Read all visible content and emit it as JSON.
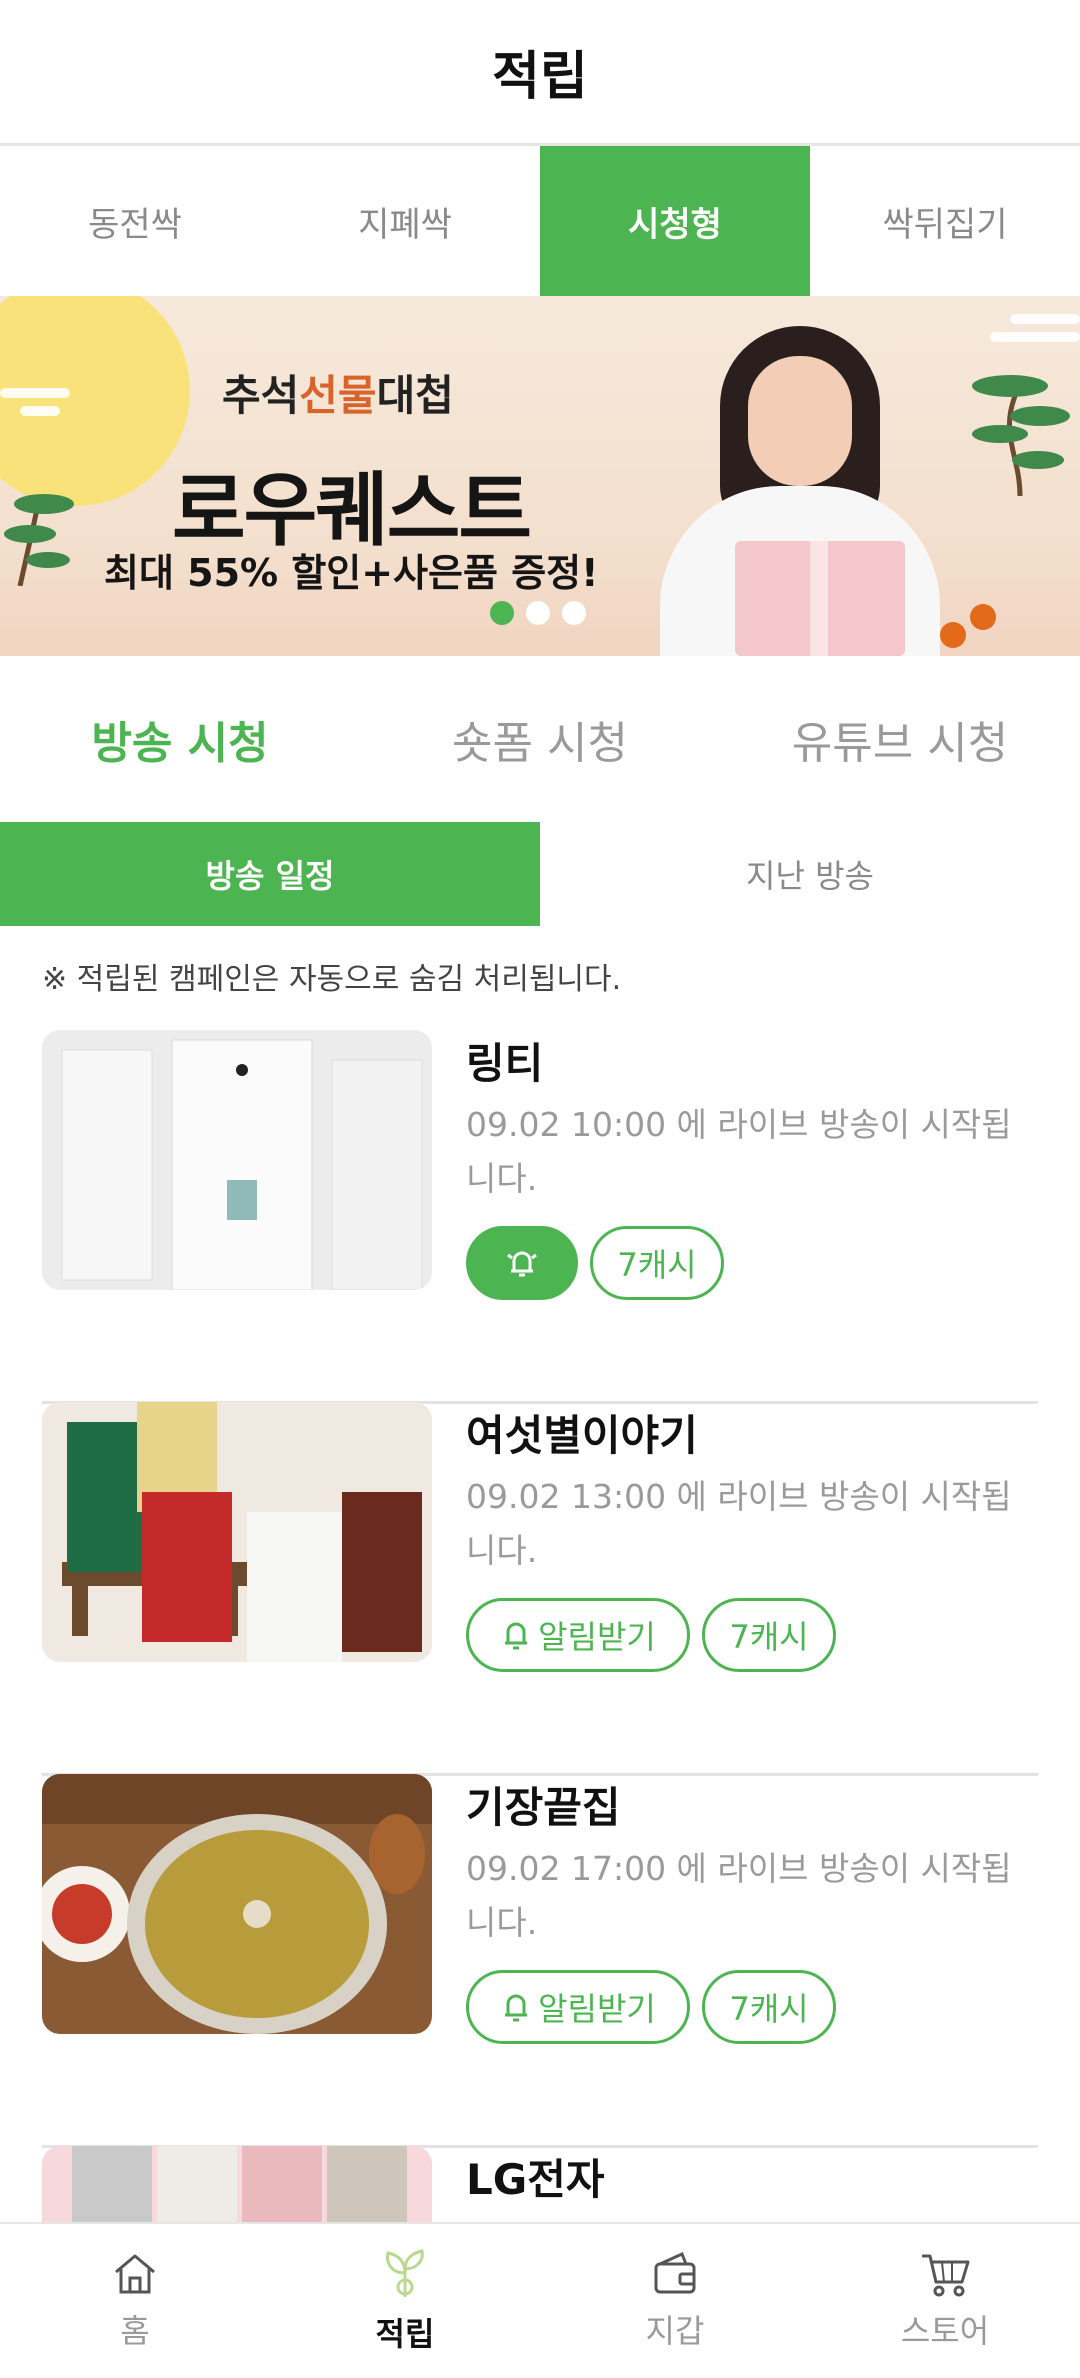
{
  "header": {
    "title": "적립"
  },
  "top_tabs": [
    {
      "label": "동전싹",
      "active": false
    },
    {
      "label": "지폐싹",
      "active": false
    },
    {
      "label": "시청형",
      "active": true
    },
    {
      "label": "싹뒤집기",
      "active": false
    }
  ],
  "banner": {
    "subtitle_prefix": "추석",
    "subtitle_highlight": "선물",
    "subtitle_suffix": "대첩",
    "brand": "로우퀘스트",
    "offer": "최대 55% 할인+사은품 증정!",
    "page_count": 3,
    "active_page": 1
  },
  "watch_tabs": [
    {
      "label": "방송 시청",
      "active": true
    },
    {
      "label": "숏폼 시청",
      "active": false
    },
    {
      "label": "유튜브 시청",
      "active": false
    }
  ],
  "segments": [
    {
      "label": "방송 일정",
      "active": true
    },
    {
      "label": "지난 방송",
      "active": false
    }
  ],
  "notice": "※ 적립된 캠페인은 자동으로 숨김 처리됩니다.",
  "broadcasts": [
    {
      "title": "링티",
      "desc": "09.02 10:00 에 라이브 방송이 시작됩니다.",
      "alarm_on": true,
      "alarm_label": "",
      "cash": "7캐시"
    },
    {
      "title": "여섯별이야기",
      "desc": "09.02 13:00 에 라이브 방송이 시작됩니다.",
      "alarm_on": false,
      "alarm_label": "알림받기",
      "cash": "7캐시"
    },
    {
      "title": "기장끝집",
      "desc": "09.02 17:00 에 라이브 방송이 시작됩니다.",
      "alarm_on": false,
      "alarm_label": "알림받기",
      "cash": "7캐시"
    },
    {
      "title": "LG전자"
    }
  ],
  "bottom_nav": [
    {
      "label": "홈",
      "icon": "home-icon",
      "active": false
    },
    {
      "label": "적립",
      "icon": "sprout-icon",
      "active": true
    },
    {
      "label": "지갑",
      "icon": "wallet-icon",
      "active": false
    },
    {
      "label": "스토어",
      "icon": "cart-icon",
      "active": false
    }
  ],
  "colors": {
    "accent": "#4cb551",
    "muted": "#9a9a9a"
  }
}
